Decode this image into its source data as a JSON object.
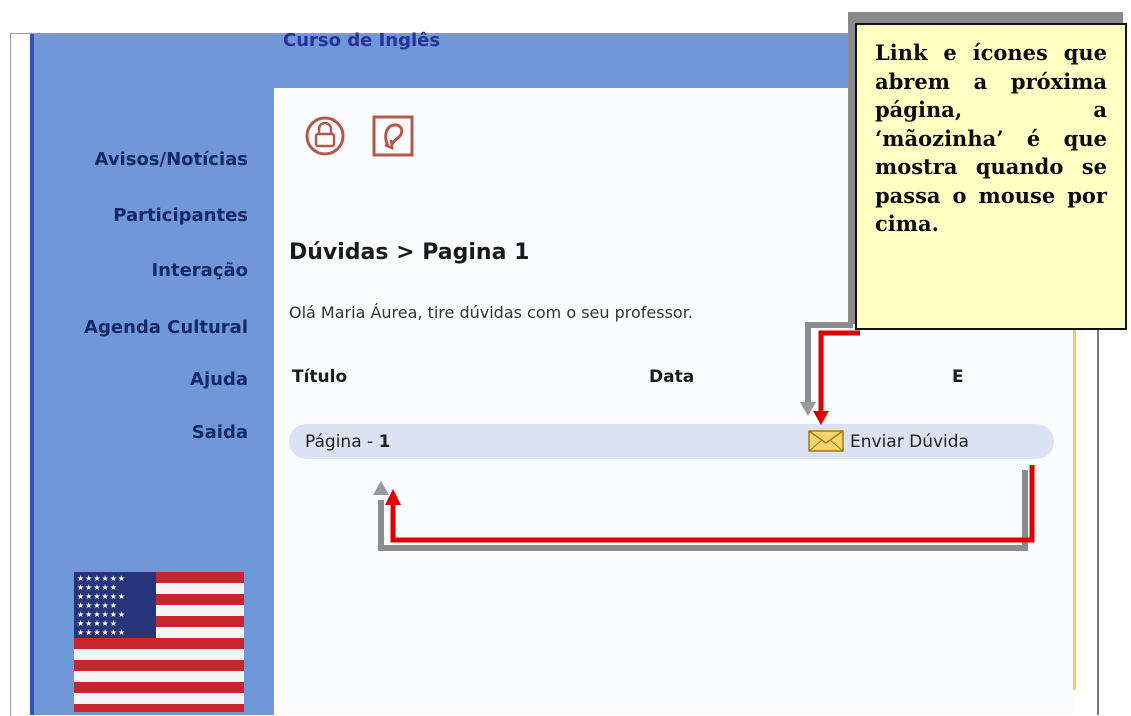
{
  "course": {
    "title": "Curso de Inglês"
  },
  "sidebar": {
    "items": [
      {
        "label": "Avisos/Notícias"
      },
      {
        "label": "Participantes"
      },
      {
        "label": "Interação"
      },
      {
        "label": "Agenda Cultural"
      },
      {
        "label": "Ajuda"
      },
      {
        "label": "Saida"
      }
    ],
    "flag_icon": "us-flag"
  },
  "toolbar": {
    "icons": [
      "lock-icon",
      "return-icon"
    ]
  },
  "main": {
    "breadcrumb": "Dúvidas > Pagina 1",
    "greeting": "Olá Maria Áurea, tire dúvidas com o seu professor.",
    "table": {
      "headers": [
        "Título",
        "Data",
        "E"
      ],
      "rows": [
        {
          "title_prefix": "Página - ",
          "title_number": "1",
          "action": "Enviar Dúvida",
          "action_icon": "envelope-icon"
        }
      ]
    }
  },
  "callout": {
    "text": "Link e ícones que abrem a próxima página, a ‘mãozinha’ é que mostra quando se passa o mouse por cima."
  },
  "colors": {
    "sidebar": "#7097d8",
    "sidebar_text": "#142a66",
    "row_bg": "#dbe3f3",
    "callout_bg": "#ffffc4",
    "arrow": "#e00000",
    "icon": "#b5584a"
  }
}
